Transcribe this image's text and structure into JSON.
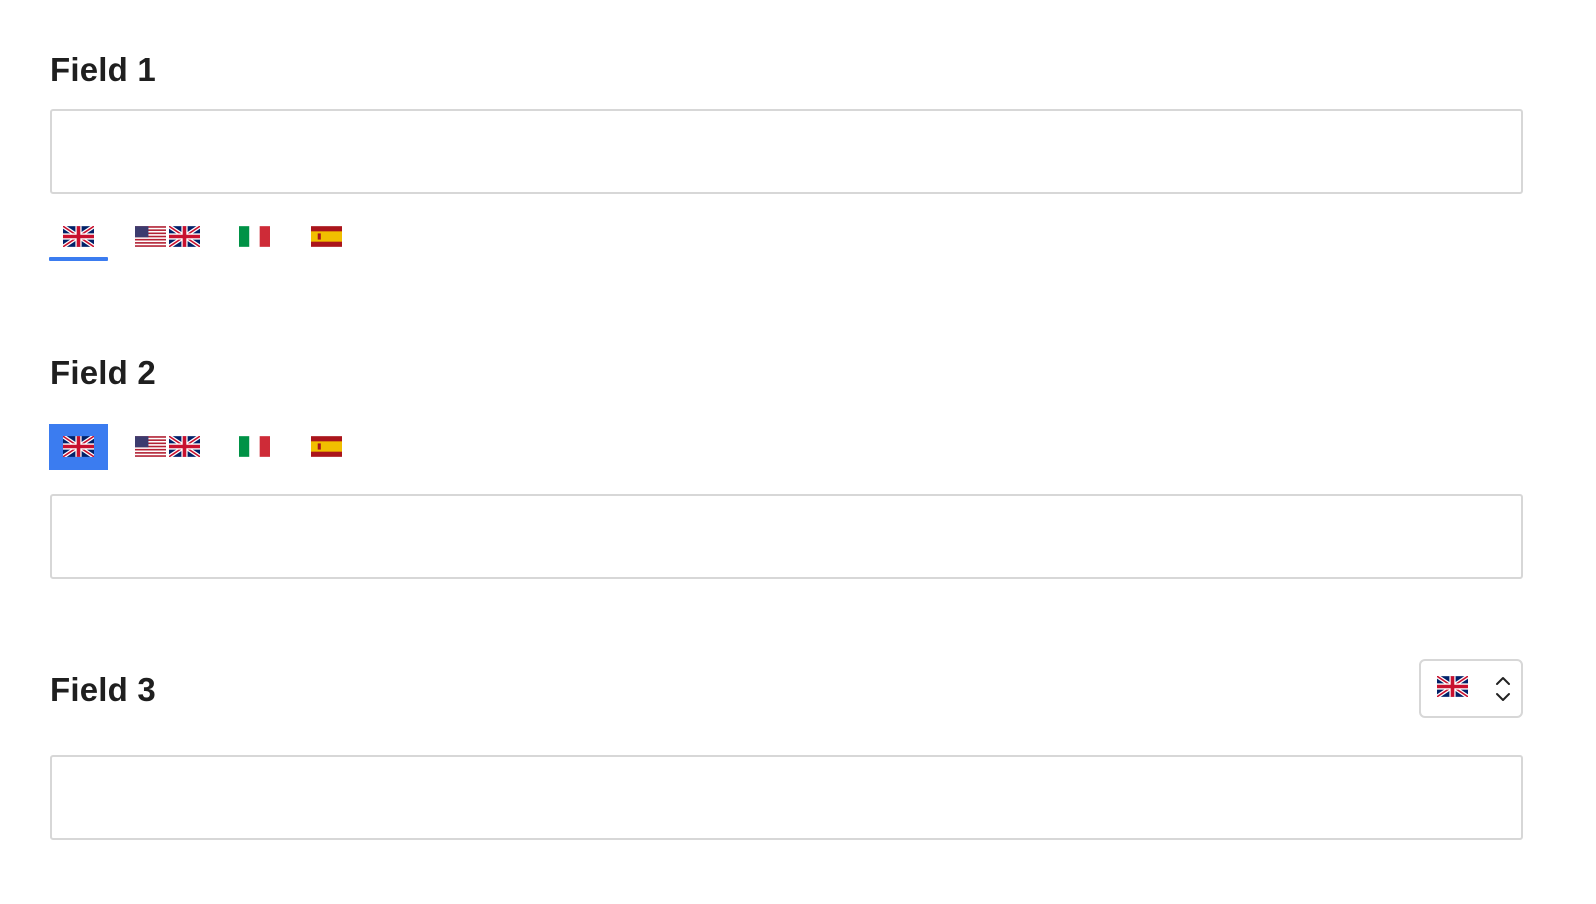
{
  "fields": [
    {
      "label": "Field 1",
      "value": "",
      "placeholder": "",
      "language_switcher": "tabs-underline",
      "active_language": "English (UK)"
    },
    {
      "label": "Field 2",
      "value": "",
      "placeholder": "",
      "language_switcher": "tabs-filled",
      "active_language": "English (UK)"
    },
    {
      "label": "Field 3",
      "value": "",
      "placeholder": "",
      "language_switcher": "select",
      "selected_language": "English (UK)"
    }
  ],
  "languages": [
    {
      "name": "English (UK)",
      "icon": "uk-flag-icon"
    },
    {
      "name": "English (US/UK)",
      "icon": "us-uk-flag-icon"
    },
    {
      "name": "Italian",
      "icon": "italy-flag-icon"
    },
    {
      "name": "Spanish",
      "icon": "spain-flag-icon"
    }
  ],
  "colors": {
    "accent": "#3b7cf0",
    "border": "#d7d7d7",
    "text": "#1f1f1f"
  }
}
